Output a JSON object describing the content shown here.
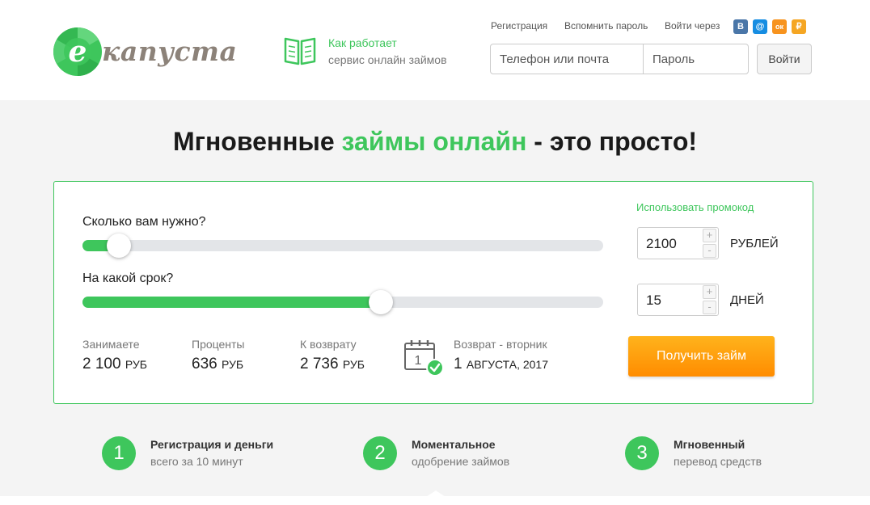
{
  "brand": {
    "logo_letter": "e",
    "logo_text": "капуста"
  },
  "how_it_works": {
    "line1": "Как работает",
    "line2": "сервис онлайн займов"
  },
  "auth": {
    "register": "Регистрация",
    "recover": "Вспомнить пароль",
    "login_via": "Войти через",
    "socials": [
      {
        "name": "vk",
        "glyph": "В",
        "color": "#4a76a8"
      },
      {
        "name": "mail",
        "glyph": "@",
        "color": "#168de2"
      },
      {
        "name": "odnoklassniki",
        "glyph": "ок",
        "color": "#f7931e"
      },
      {
        "name": "yandex-money",
        "glyph": "₽",
        "color": "#f5a623"
      }
    ],
    "login_placeholder": "Телефон или почта",
    "password_placeholder": "Пароль",
    "submit": "Войти"
  },
  "hero": {
    "title_part1": "Мгновенные ",
    "title_green": "займы онлайн",
    "title_part2": " - это просто!"
  },
  "calculator": {
    "amount_label": "Сколько вам нужно?",
    "amount_value": "2100",
    "amount_unit": "РУБЛЕЙ",
    "amount_slider_fraction": 0.07,
    "term_label": "На какой срок?",
    "term_value": "15",
    "term_unit": "ДНЕЙ",
    "term_slider_fraction": 0.573,
    "promo_link": "Использовать промокод",
    "plus": "+",
    "minus": "-",
    "borrow_label": "Занимаете",
    "borrow_value": "2 100",
    "interest_label": "Проценты",
    "interest_value": "636",
    "repay_label": "К возврату",
    "repay_value": "2 736",
    "currency": "РУБ",
    "return_label": "Возврат - вторник",
    "return_day": "1",
    "return_month_year": "АВГУСТА, 2017",
    "calendar_day": "1",
    "cta": "Получить займ"
  },
  "steps": [
    {
      "number": "1",
      "title": "Регистрация и деньги",
      "subtitle": "всего за 10 минут"
    },
    {
      "number": "2",
      "title": "Моментальное",
      "subtitle": "одобрение займов"
    },
    {
      "number": "3",
      "title": "Мгновенный",
      "subtitle": "перевод средств"
    }
  ],
  "colors": {
    "accent": "#3ec65c",
    "cta": "#ff9a0a",
    "text": "#222222"
  }
}
